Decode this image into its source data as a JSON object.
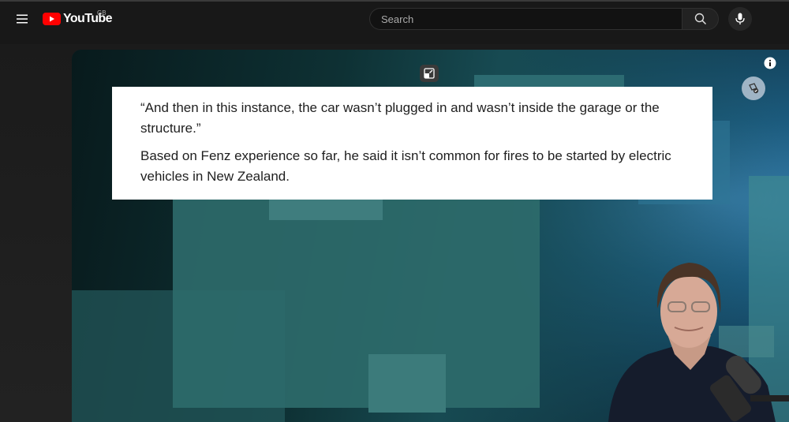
{
  "header": {
    "logo_text": "YouTube",
    "region_code": "GB",
    "search_placeholder": "Search",
    "icons": [
      "menu-icon",
      "youtube-logo-icon",
      "search-icon",
      "microphone-icon"
    ]
  },
  "video": {
    "quote_paragraphs": [
      "“And then in this instance, the car wasn’t plugged in and wasn’t inside the garage or the structure.”",
      "Based on Fenz experience so far, he said it isn’t common for fires to be started by electric vehicles in New Zealand."
    ],
    "icons": [
      "miniplayer-icon",
      "info-icon",
      "card-icon"
    ]
  },
  "colors": {
    "brand_red": "#ff0000",
    "topbar_bg": "#181818",
    "quote_bg": "#ffffff"
  }
}
